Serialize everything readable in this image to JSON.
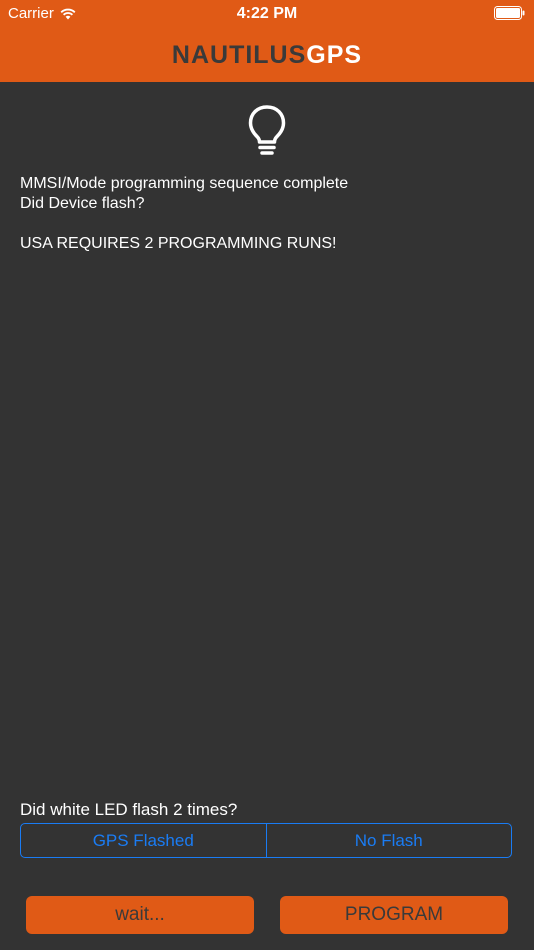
{
  "status_bar": {
    "carrier": "Carrier",
    "time": "4:22 PM",
    "wifi_icon": "wifi-icon",
    "battery_icon": "battery-icon"
  },
  "header": {
    "logo_part1": "NAUTILUS",
    "logo_part2": "GPS",
    "background_color": "#e05a16"
  },
  "content": {
    "bulb_icon": "lightbulb-icon",
    "lines": [
      "MMSI/Mode programming sequence complete",
      "Did Device flash?",
      "",
      "USA REQUIRES 2 PROGRAMMING RUNS!"
    ]
  },
  "question": {
    "prompt": "Did white LED flash 2 times?",
    "options": [
      "GPS Flashed",
      "No Flash"
    ],
    "accent_color": "#1a7cf4"
  },
  "buttons": {
    "wait_label": "wait...",
    "program_label": "PROGRAM"
  }
}
